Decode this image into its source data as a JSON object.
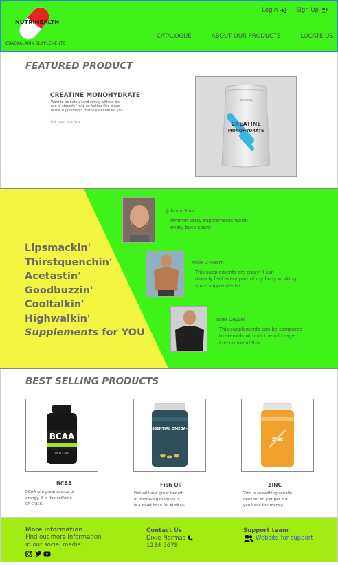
{
  "header": {
    "logo_text": "NUTRIHEALTH",
    "tagline": "CRACKALAKIN SUPPLEMENTS",
    "login": "Login",
    "separator": "|",
    "signup": "Sign Up",
    "nav": [
      "CATALOGUE",
      "ABOUT OUR PRODUCTS",
      "LOCATE US"
    ]
  },
  "featured": {
    "title": "FEATURED PRODUCT",
    "product_name": "CREATINE MONOHYDRATE",
    "description_lines": [
      "Want to be natural and strong without the",
      "use of steroids? look no further this is one",
      "of the supplements that is essential for you"
    ],
    "link_text": "Get yours now here",
    "bag_brand": "MYPROTEIN",
    "bag_label_1": "CREATINE",
    "bag_label_2": "MONOHYDRATE"
  },
  "testimonials": {
    "slogans": [
      "Lipsmackin'",
      "Thirstquenchin'",
      "Acetastin'",
      "Goodbuzzin'",
      "Cooltalkin'",
      "Highwalkin'"
    ],
    "slogan_em": "Supplements",
    "slogan_tail": "for YOU",
    "reviews": [
      {
        "name": "Johnny Sins",
        "lines": [
          "Mmmm Tasty supplements worth",
          "every buck spent!"
        ]
      },
      {
        "name": "Mike O'Hearn",
        "lines": [
          "This supplements are crazy! I can",
          "already feel every part of my body working",
          "more supplements!"
        ]
      },
      {
        "name": "Noel Deyzel",
        "lines": [
          "This supplements can be compared",
          "to steroids without the roid rage",
          "I recommend this."
        ]
      }
    ]
  },
  "bestselling": {
    "title": "BEST SELLING PRODUCTS",
    "products": [
      {
        "name": "BCAA",
        "label": "BCAA",
        "sublabel": "1000 CAPS",
        "lines": [
          "BCAA is a great source of",
          "energy. It is like caffeine",
          "on crack."
        ]
      },
      {
        "name": "Fish Oil",
        "label": "ESSENTIAL OMEGA-3",
        "sublabel": "",
        "lines": [
          "Fish oil have great benefit",
          "of improving memory. It",
          "is a must have for bimbos."
        ]
      },
      {
        "name": "ZINC",
        "label": "ZINC",
        "sublabel": "",
        "lines": [
          "Zinc is something usually",
          "defcient so just get it if",
          "you have the money."
        ]
      }
    ]
  },
  "footer": {
    "more_info_title": "More information",
    "more_info_lines": [
      "Find out more information",
      "in our social media!"
    ],
    "contact_title": "Contact Us",
    "contact_name": "Dixie Normas",
    "contact_phone": "1234 5678",
    "support_title": "Support team",
    "support_link": "Website for support"
  },
  "colors": {
    "header_bg": "#3ef21a",
    "testimonial_green": "#3ef21a",
    "testimonial_yellow": "#f2f541",
    "footer_bg": "#a2ec13",
    "link": "#2f6fd6"
  }
}
